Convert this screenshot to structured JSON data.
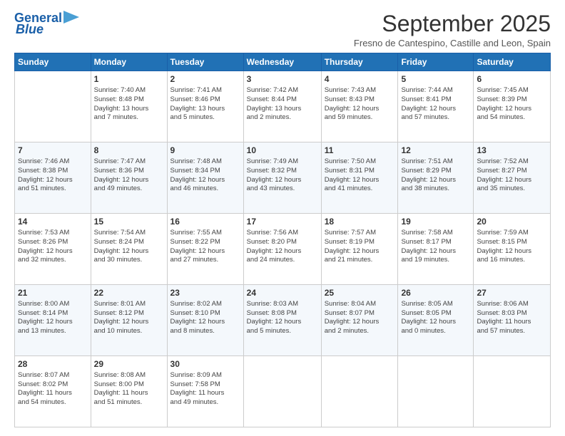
{
  "logo": {
    "line1": "General",
    "line2": "Blue"
  },
  "header": {
    "month_year": "September 2025",
    "location": "Fresno de Cantespino, Castille and Leon, Spain"
  },
  "days_of_week": [
    "Sunday",
    "Monday",
    "Tuesday",
    "Wednesday",
    "Thursday",
    "Friday",
    "Saturday"
  ],
  "weeks": [
    [
      {
        "day": "",
        "info": ""
      },
      {
        "day": "1",
        "info": "Sunrise: 7:40 AM\nSunset: 8:48 PM\nDaylight: 13 hours\nand 7 minutes."
      },
      {
        "day": "2",
        "info": "Sunrise: 7:41 AM\nSunset: 8:46 PM\nDaylight: 13 hours\nand 5 minutes."
      },
      {
        "day": "3",
        "info": "Sunrise: 7:42 AM\nSunset: 8:44 PM\nDaylight: 13 hours\nand 2 minutes."
      },
      {
        "day": "4",
        "info": "Sunrise: 7:43 AM\nSunset: 8:43 PM\nDaylight: 12 hours\nand 59 minutes."
      },
      {
        "day": "5",
        "info": "Sunrise: 7:44 AM\nSunset: 8:41 PM\nDaylight: 12 hours\nand 57 minutes."
      },
      {
        "day": "6",
        "info": "Sunrise: 7:45 AM\nSunset: 8:39 PM\nDaylight: 12 hours\nand 54 minutes."
      }
    ],
    [
      {
        "day": "7",
        "info": "Sunrise: 7:46 AM\nSunset: 8:38 PM\nDaylight: 12 hours\nand 51 minutes."
      },
      {
        "day": "8",
        "info": "Sunrise: 7:47 AM\nSunset: 8:36 PM\nDaylight: 12 hours\nand 49 minutes."
      },
      {
        "day": "9",
        "info": "Sunrise: 7:48 AM\nSunset: 8:34 PM\nDaylight: 12 hours\nand 46 minutes."
      },
      {
        "day": "10",
        "info": "Sunrise: 7:49 AM\nSunset: 8:32 PM\nDaylight: 12 hours\nand 43 minutes."
      },
      {
        "day": "11",
        "info": "Sunrise: 7:50 AM\nSunset: 8:31 PM\nDaylight: 12 hours\nand 41 minutes."
      },
      {
        "day": "12",
        "info": "Sunrise: 7:51 AM\nSunset: 8:29 PM\nDaylight: 12 hours\nand 38 minutes."
      },
      {
        "day": "13",
        "info": "Sunrise: 7:52 AM\nSunset: 8:27 PM\nDaylight: 12 hours\nand 35 minutes."
      }
    ],
    [
      {
        "day": "14",
        "info": "Sunrise: 7:53 AM\nSunset: 8:26 PM\nDaylight: 12 hours\nand 32 minutes."
      },
      {
        "day": "15",
        "info": "Sunrise: 7:54 AM\nSunset: 8:24 PM\nDaylight: 12 hours\nand 30 minutes."
      },
      {
        "day": "16",
        "info": "Sunrise: 7:55 AM\nSunset: 8:22 PM\nDaylight: 12 hours\nand 27 minutes."
      },
      {
        "day": "17",
        "info": "Sunrise: 7:56 AM\nSunset: 8:20 PM\nDaylight: 12 hours\nand 24 minutes."
      },
      {
        "day": "18",
        "info": "Sunrise: 7:57 AM\nSunset: 8:19 PM\nDaylight: 12 hours\nand 21 minutes."
      },
      {
        "day": "19",
        "info": "Sunrise: 7:58 AM\nSunset: 8:17 PM\nDaylight: 12 hours\nand 19 minutes."
      },
      {
        "day": "20",
        "info": "Sunrise: 7:59 AM\nSunset: 8:15 PM\nDaylight: 12 hours\nand 16 minutes."
      }
    ],
    [
      {
        "day": "21",
        "info": "Sunrise: 8:00 AM\nSunset: 8:14 PM\nDaylight: 12 hours\nand 13 minutes."
      },
      {
        "day": "22",
        "info": "Sunrise: 8:01 AM\nSunset: 8:12 PM\nDaylight: 12 hours\nand 10 minutes."
      },
      {
        "day": "23",
        "info": "Sunrise: 8:02 AM\nSunset: 8:10 PM\nDaylight: 12 hours\nand 8 minutes."
      },
      {
        "day": "24",
        "info": "Sunrise: 8:03 AM\nSunset: 8:08 PM\nDaylight: 12 hours\nand 5 minutes."
      },
      {
        "day": "25",
        "info": "Sunrise: 8:04 AM\nSunset: 8:07 PM\nDaylight: 12 hours\nand 2 minutes."
      },
      {
        "day": "26",
        "info": "Sunrise: 8:05 AM\nSunset: 8:05 PM\nDaylight: 12 hours\nand 0 minutes."
      },
      {
        "day": "27",
        "info": "Sunrise: 8:06 AM\nSunset: 8:03 PM\nDaylight: 11 hours\nand 57 minutes."
      }
    ],
    [
      {
        "day": "28",
        "info": "Sunrise: 8:07 AM\nSunset: 8:02 PM\nDaylight: 11 hours\nand 54 minutes."
      },
      {
        "day": "29",
        "info": "Sunrise: 8:08 AM\nSunset: 8:00 PM\nDaylight: 11 hours\nand 51 minutes."
      },
      {
        "day": "30",
        "info": "Sunrise: 8:09 AM\nSunset: 7:58 PM\nDaylight: 11 hours\nand 49 minutes."
      },
      {
        "day": "",
        "info": ""
      },
      {
        "day": "",
        "info": ""
      },
      {
        "day": "",
        "info": ""
      },
      {
        "day": "",
        "info": ""
      }
    ]
  ]
}
